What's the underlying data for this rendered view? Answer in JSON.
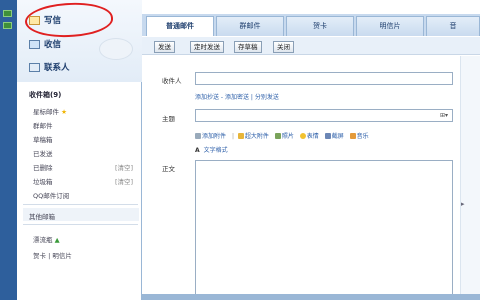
{
  "sidebar": {
    "write": "写信",
    "inbox": "收信",
    "contacts": "联系人",
    "folders": [
      {
        "label": "收件箱(9)",
        "head": true
      },
      {
        "label": "星标邮件",
        "star": "★"
      },
      {
        "label": "群邮件"
      },
      {
        "label": "草稿箱"
      },
      {
        "label": "已发送"
      },
      {
        "label": "已删除",
        "action": "[清空]"
      },
      {
        "label": "垃圾箱",
        "action": "[清空]"
      },
      {
        "label": "QQ邮件订阅"
      }
    ],
    "other_mailbox": "其他邮箱",
    "extras": [
      "漂流瓶",
      "贺卡 | 明信片"
    ]
  },
  "tabs": [
    "普通邮件",
    "群邮件",
    "贺卡",
    "明信片",
    "音"
  ],
  "toolbar": {
    "send": "发送",
    "timed_send": "定时发送",
    "save_draft": "存草稿",
    "close": "关闭"
  },
  "compose": {
    "to_label": "收件人",
    "link_add_cc": "添加抄送",
    "link_add_bcc": "添加密送",
    "link_separate": "分别发送",
    "subject_label": "主题",
    "subject_icon": "⊞▾",
    "attach": {
      "add": "添加附件",
      "large": "超大附件",
      "photo": "照片",
      "emoji": "表情",
      "screenshot": "截屏",
      "music": "音乐",
      "text_format": "文字格式"
    },
    "body_label": "正文"
  },
  "colors": {
    "accent": "#2a5da8",
    "highlight_ring": "#e02020"
  }
}
